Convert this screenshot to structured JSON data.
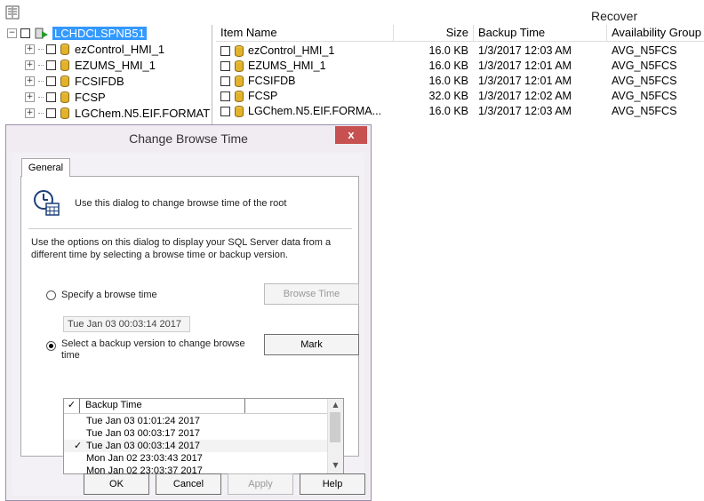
{
  "app": {
    "recover_label": "Recover"
  },
  "tree": {
    "root": "LCHDCLSPNB51",
    "items": [
      "ezControl_HMI_1",
      "EZUMS_HMI_1",
      "FCSIFDB",
      "FCSP",
      "LGChem.N5.EIF.FORMAT"
    ]
  },
  "list": {
    "headers": [
      "Item Name",
      "Size",
      "Backup Time",
      "Availability Group"
    ],
    "rows": [
      {
        "name": "ezControl_HMI_1",
        "size": "16.0 KB",
        "time": "1/3/2017 12:03 AM",
        "ag": "AVG_N5FCS"
      },
      {
        "name": "EZUMS_HMI_1",
        "size": "16.0 KB",
        "time": "1/3/2017 12:01 AM",
        "ag": "AVG_N5FCS"
      },
      {
        "name": "FCSIFDB",
        "size": "16.0 KB",
        "time": "1/3/2017 12:01 AM",
        "ag": "AVG_N5FCS"
      },
      {
        "name": "FCSP",
        "size": "32.0 KB",
        "time": "1/3/2017 12:02 AM",
        "ag": "AVG_N5FCS"
      },
      {
        "name": "LGChem.N5.EIF.FORMA...",
        "size": "16.0 KB",
        "time": "1/3/2017 12:03 AM",
        "ag": "AVG_N5FCS"
      }
    ]
  },
  "dialog": {
    "title": "Change Browse Time",
    "close": "x",
    "tab": "General",
    "info": "Use this dialog to change browse time of the root",
    "description": "Use the options on this dialog to display your SQL Server data from a different time by selecting a browse time or backup version.",
    "option_browse": "Specify a browse time",
    "browse_time_value": "Tue Jan 03 00:03:14 2017",
    "browse_time_button": "Browse Time",
    "option_backup": "Select a backup version to change browse time",
    "mark_button": "Mark",
    "grid_header": "Backup Time",
    "grid_check_header": "✓",
    "versions": [
      {
        "time": "Tue Jan 03 01:01:24 2017",
        "checked": ""
      },
      {
        "time": "Tue Jan 03 00:03:17 2017",
        "checked": ""
      },
      {
        "time": "Tue Jan 03 00:03:14 2017",
        "checked": "✓"
      },
      {
        "time": "Mon Jan 02 23:03:43 2017",
        "checked": ""
      },
      {
        "time": "Mon Jan 02 23:03:37 2017",
        "checked": ""
      }
    ],
    "buttons": {
      "ok": "OK",
      "cancel": "Cancel",
      "apply": "Apply",
      "help": "Help"
    }
  }
}
